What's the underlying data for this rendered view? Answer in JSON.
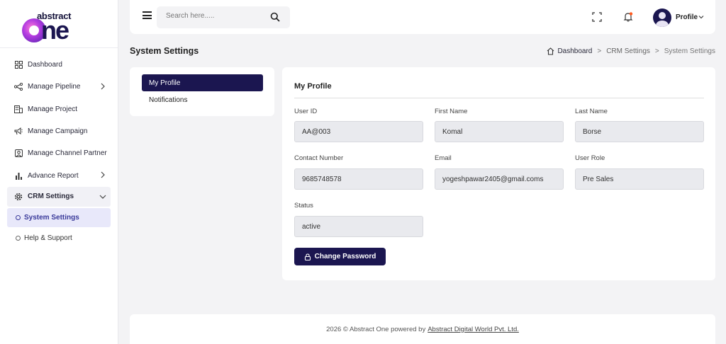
{
  "brand": {
    "small": "abstract",
    "big": "ne"
  },
  "sidebar": {
    "items": [
      {
        "label": "Dashboard",
        "icon": "grid-icon"
      },
      {
        "label": "Manage Pipeline",
        "icon": "share-icon"
      },
      {
        "label": "Manage Project",
        "icon": "building-icon"
      },
      {
        "label": "Manage Campaign",
        "icon": "megaphone-icon"
      },
      {
        "label": "Manage Channel Partner",
        "icon": "user-square-icon"
      },
      {
        "label": "Advance Report",
        "icon": "bar-chart-icon"
      },
      {
        "label": "CRM Settings",
        "icon": "gear-icon"
      }
    ],
    "sub": {
      "system": "System Settings",
      "help": "Help & Support"
    }
  },
  "header": {
    "search_placeholder": "Search here.....",
    "profile_label": "Profile"
  },
  "page": {
    "title": "System Settings",
    "breadcrumb": [
      "Dashboard",
      "CRM Settings",
      "System Settings"
    ]
  },
  "tabs": {
    "my_profile": "My Profile",
    "notifications": "Notifications"
  },
  "profile": {
    "title": "My Profile",
    "fields": [
      {
        "label": "User ID",
        "value": "AA@003"
      },
      {
        "label": "First Name",
        "value": "Komal"
      },
      {
        "label": "Last Name",
        "value": "Borse"
      },
      {
        "label": "Contact Number",
        "value": "9685748578"
      },
      {
        "label": "Email",
        "value": "yogeshpawar2405@gmail.coms"
      },
      {
        "label": "User Role",
        "value": "Pre Sales"
      },
      {
        "label": "Status",
        "value": "active"
      }
    ],
    "change_password": "Change Password"
  },
  "footer": {
    "text": "2026 © Abstract One powered by",
    "company": "Abstract Digital World Pvt. Ltd."
  },
  "colors": {
    "primary": "#1b1650",
    "active_sub_bg": "#e8e8fa",
    "field_bg": "#e9eaee"
  }
}
